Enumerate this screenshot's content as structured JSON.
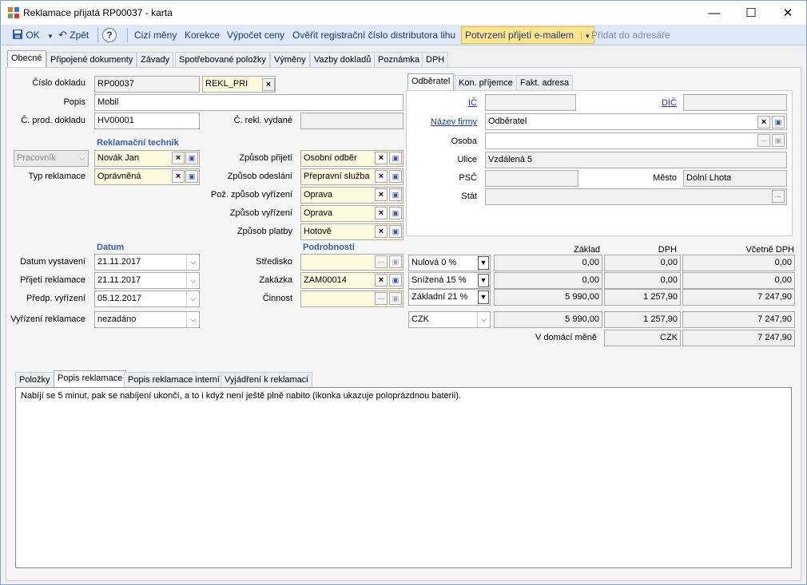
{
  "window": {
    "title": "Reklamace přijatá RP00037 - karta",
    "minimize": "—",
    "maximize": "☐",
    "close": "✕"
  },
  "toolbar": {
    "ok": "OK",
    "back": "Zpět",
    "help": "?",
    "foreign_currency": "Cizí měny",
    "correction": "Korekce",
    "calc_prices": "Výpočet ceny",
    "verify_reg": "Ověřit registrační číslo distributora lihu",
    "email_confirm": "Potvrzení přijetí e-mailem",
    "add_address": "Přidat do adresáře"
  },
  "tabs": [
    "Obecné",
    "Připojené dokumenty",
    "Závady",
    "Spotřebované položky",
    "Výměny",
    "Vazby dokladů",
    "Poznámka",
    "DPH"
  ],
  "form": {
    "doc_number_label": "Číslo dokladu",
    "doc_number": "RP00037",
    "doc_type": "REKL_PRI",
    "description_label": "Popis",
    "description": "Mobil",
    "sale_doc_label": "Č. prod. dokladu",
    "sale_doc": "HV00001",
    "issued_label": "Č. rekl. vydané",
    "issued": "",
    "tech_section": "Reklamační technik",
    "worker_select": "Pracovník",
    "worker": "Novák Jan",
    "type_label": "Typ reklamace",
    "type": "Oprávněná",
    "receipt_label": "Způsob přijetí",
    "receipt": "Osobní odběr",
    "send_label": "Způsob odeslání",
    "send": "Přepravní služba",
    "req_settle_label": "Pož. způsob vyřízení",
    "req_settle": "Oprava",
    "settle_label": "Způsob vyřízení",
    "settle": "Oprava",
    "payment_label": "Způsob platby",
    "payment": "Hotově",
    "date_section": "Datum",
    "issue_date_label": "Datum vystavení",
    "issue_date": "21.11.2017",
    "receive_date_label": "Přijetí reklamace",
    "receive_date": "21.11.2017",
    "expected_date_label": "Předp. vyřízení",
    "expected_date": "05.12.2017",
    "resolution_label": "Vyřízení reklamace",
    "resolution": "nezadáno",
    "details_section": "Podrobnosti",
    "center_label": "Středisko",
    "center": "",
    "order_label": "Zakázka",
    "order": "ZAM00014",
    "activity_label": "Činnost",
    "activity": ""
  },
  "partner": {
    "tabs": [
      "Odběratel",
      "Kon. příjemce",
      "Fakt. adresa"
    ],
    "ic_label": "IČ",
    "ic": "",
    "dic_label": "DIČ",
    "dic": "",
    "company_label": "Název firmy",
    "company": "Odběratel",
    "person_label": "Osoba",
    "person": "",
    "street_label": "Ulice",
    "street": "Vzdálená 5",
    "zip_label": "PSČ",
    "zip": "",
    "city_label": "Město",
    "city": "Dolní Lhota",
    "country_label": "Stát",
    "country": ""
  },
  "vat": {
    "headers": {
      "base": "Základ",
      "vat": "DPH",
      "incl": "Včetně DPH"
    },
    "rows": [
      {
        "rate": "Nulová 0 %",
        "base": "0,00",
        "vat": "0,00",
        "incl": "0,00"
      },
      {
        "rate": "Snížená 15 %",
        "base": "0,00",
        "vat": "0,00",
        "incl": "0,00"
      },
      {
        "rate": "Základní 21 %",
        "base": "5 990,00",
        "vat": "1 257,90",
        "incl": "7 247,90"
      }
    ],
    "currency": "CZK",
    "total": {
      "base": "5 990,00",
      "vat": "1 257,90",
      "incl": "7 247,90"
    },
    "domestic_label": "V domácí měně",
    "domestic_currency": "CZK",
    "domestic_total": "7 247,90"
  },
  "bottom": {
    "tabs": [
      "Položky",
      "Popis reklamace",
      "Popis reklamace interní",
      "Vyjádření k reklamaci"
    ],
    "text": "Nabíjí se 5 minut, pak se nabíjení ukončí, a to i když není ještě plně nabito (ikonka ukazuje poloprázdnou baterii)."
  }
}
